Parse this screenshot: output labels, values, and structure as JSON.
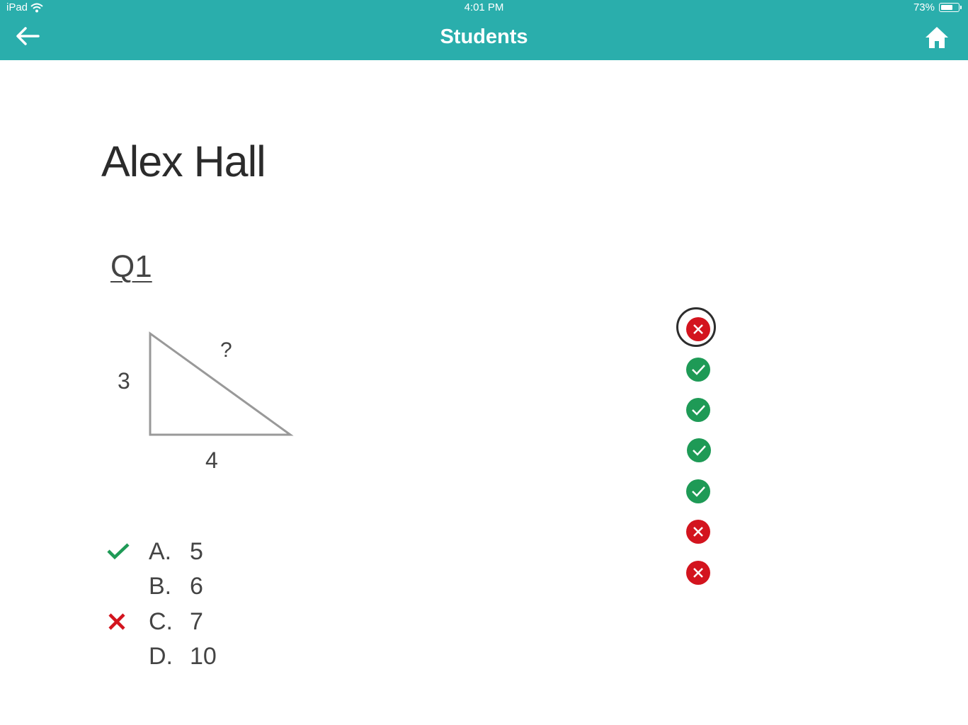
{
  "status_bar": {
    "device": "iPad",
    "time": "4:01 PM",
    "battery": "73%",
    "battery_level": 0.73
  },
  "nav": {
    "title": "Students",
    "back_icon": "arrow-left-icon",
    "home_icon": "home-icon"
  },
  "student": {
    "name": "Alex Hall"
  },
  "question": {
    "label": "Q1",
    "diagram": {
      "side_a": "3",
      "side_b": "4",
      "hypotenuse": "?"
    },
    "answers": [
      {
        "letter": "A.",
        "value": "5",
        "mark": "correct"
      },
      {
        "letter": "B.",
        "value": "6",
        "mark": "none"
      },
      {
        "letter": "C.",
        "value": "7",
        "mark": "incorrect"
      },
      {
        "letter": "D.",
        "value": "10",
        "mark": "none"
      }
    ]
  },
  "results": [
    {
      "status": "incorrect",
      "selected": true
    },
    {
      "status": "correct",
      "selected": false
    },
    {
      "status": "correct",
      "selected": false
    },
    {
      "status": "correct",
      "selected": false
    },
    {
      "status": "correct",
      "selected": false
    },
    {
      "status": "incorrect",
      "selected": false
    },
    {
      "status": "incorrect",
      "selected": false
    }
  ],
  "colors": {
    "header": "#2aaeac",
    "correct": "#1e9a56",
    "incorrect": "#d3141e"
  }
}
